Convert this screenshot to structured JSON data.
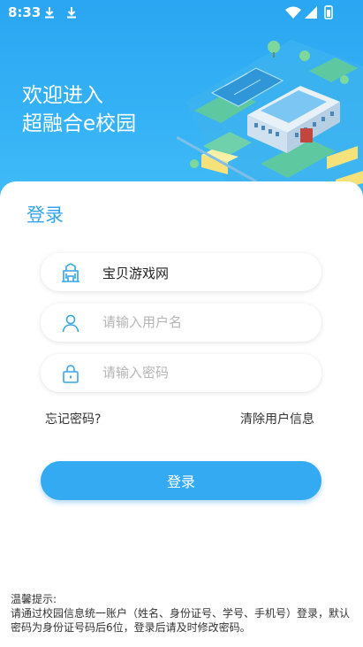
{
  "status_bar": {
    "time": "8:33",
    "icons": [
      "download-icon",
      "download-icon",
      "wifi-icon",
      "signal-icon",
      "battery-icon"
    ]
  },
  "header": {
    "line1": "欢迎进入",
    "line2": "超融合e校园",
    "background_color": "#2aa6f2"
  },
  "login": {
    "heading": "登录",
    "school_field": {
      "value": "宝贝游戏网",
      "icon": "school-building-icon"
    },
    "username_field": {
      "value": "",
      "placeholder": "请输入用户名",
      "icon": "user-icon"
    },
    "password_field": {
      "value": "",
      "placeholder": "请输入密码",
      "icon": "lock-icon"
    },
    "forgot_password": "忘记密码?",
    "clear_user_info": "清除用户信息",
    "submit_label": "登录",
    "accent_color": "#33aaf2"
  },
  "notice": {
    "title": "温馨提示:",
    "body": "请通过校园信息统一账户（姓名、身份证号、学号、手机号）登录，默认密码为身份证号码后6位，登录后请及时修改密码。"
  }
}
